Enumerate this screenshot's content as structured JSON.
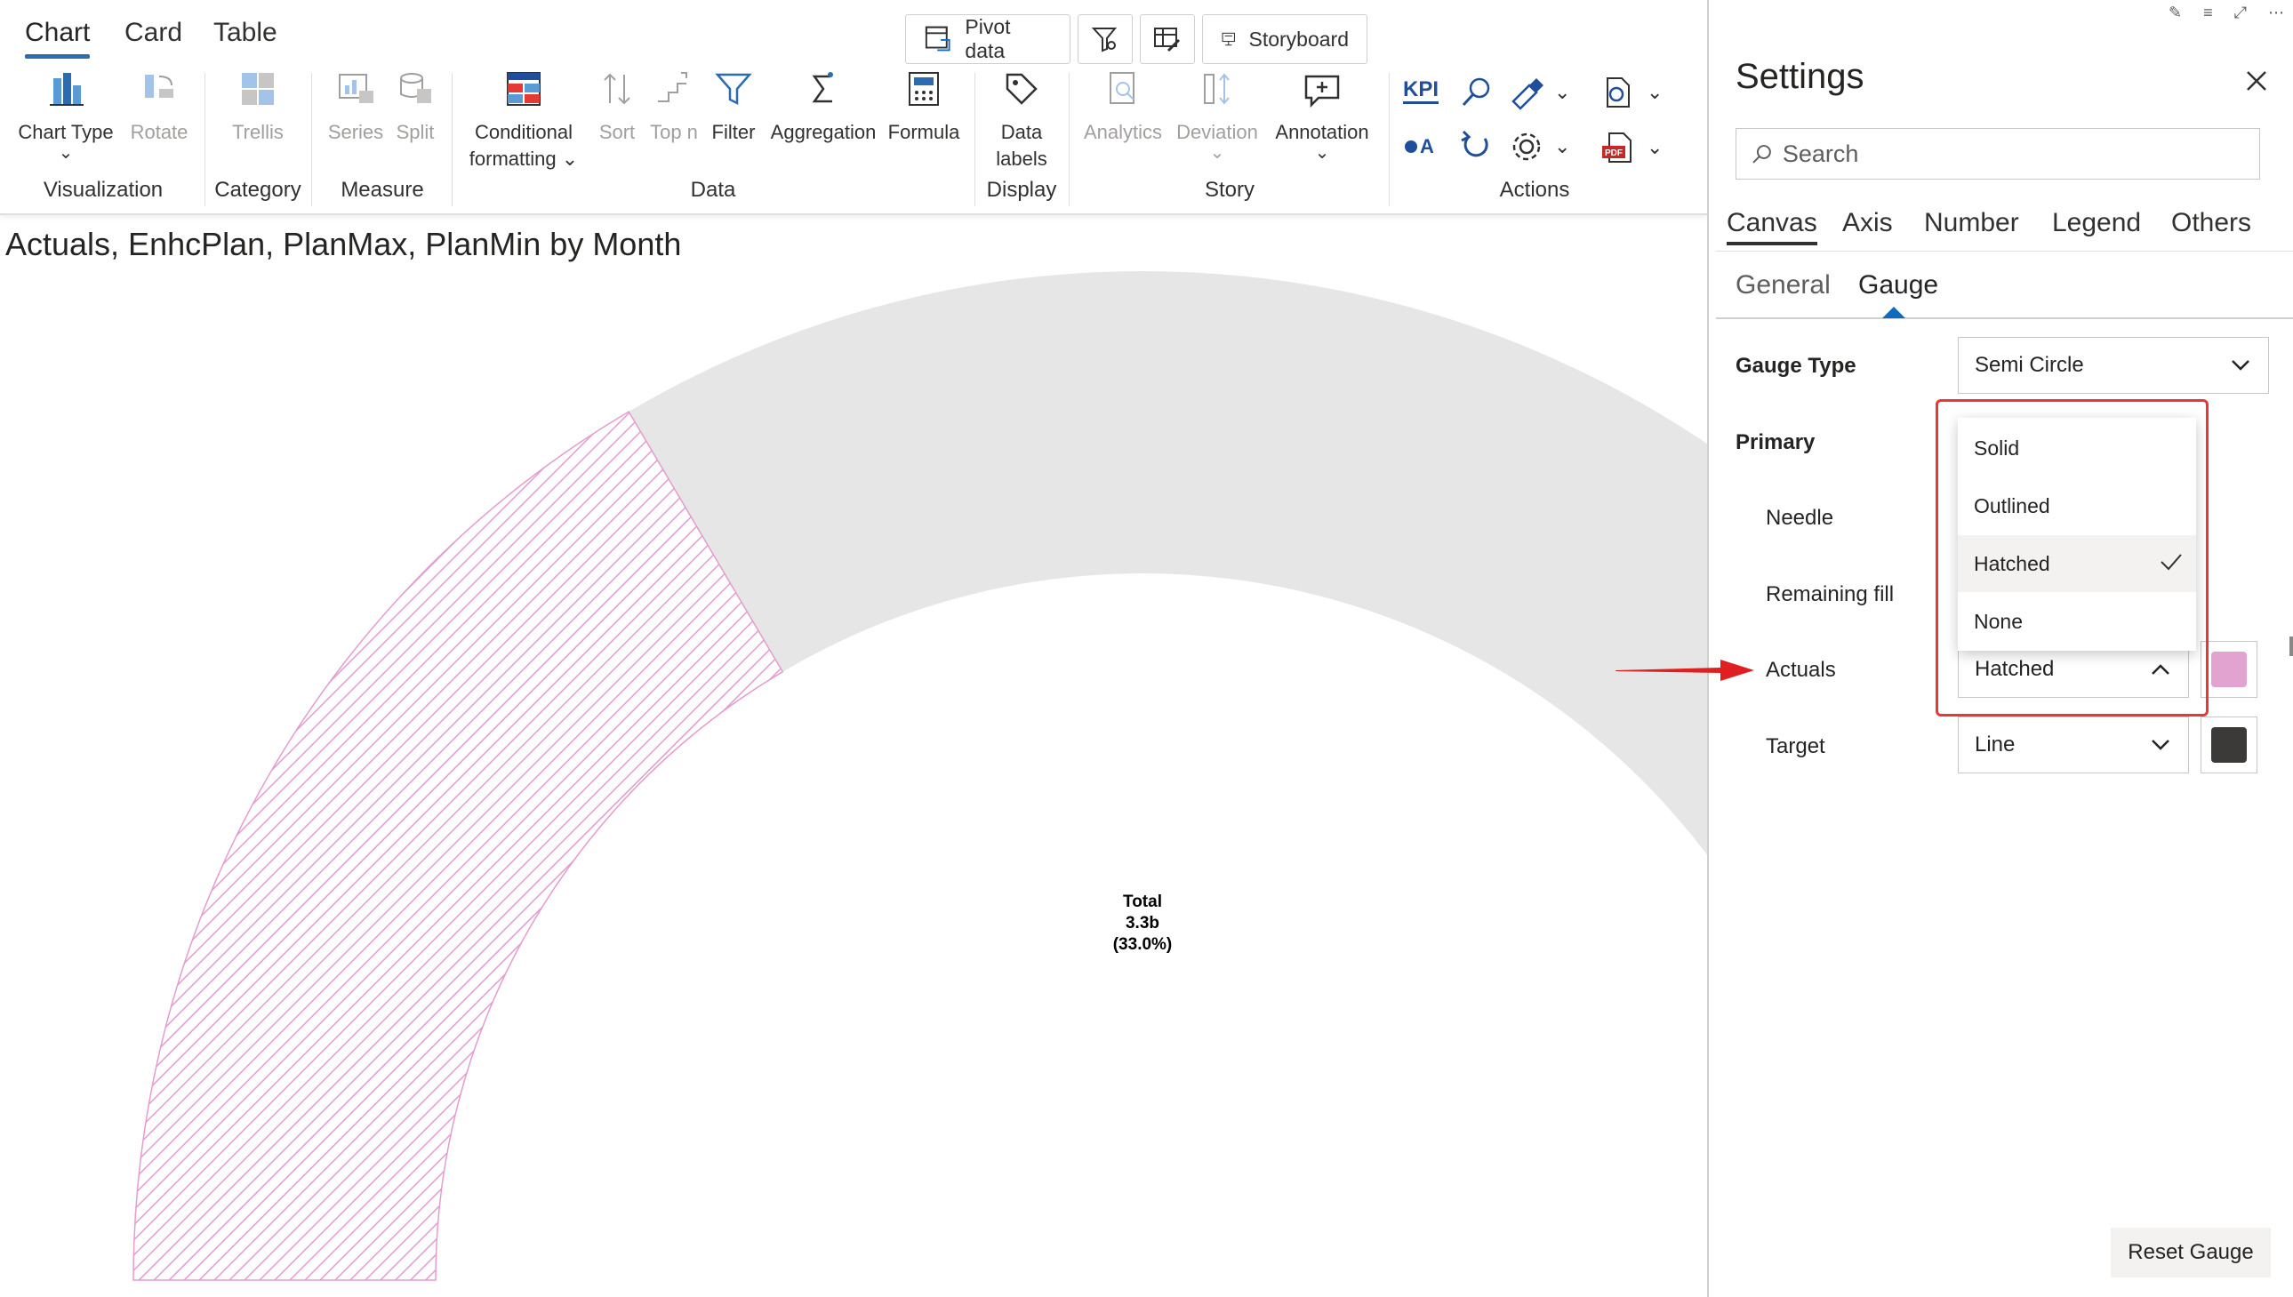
{
  "ribbon": {
    "tabs": [
      "Chart",
      "Card",
      "Table"
    ],
    "top_buttons": {
      "pivot": "Pivot data",
      "storyboard": "Storyboard"
    },
    "buttons": {
      "chart_type": "Chart Type",
      "rotate": "Rotate",
      "trellis": "Trellis",
      "series": "Series",
      "split": "Split",
      "conditional_1": "Conditional",
      "conditional_2": "formatting",
      "sort": "Sort",
      "topn": "Top n",
      "filter": "Filter",
      "aggregation": "Aggregation",
      "formula": "Formula",
      "data_labels_1": "Data",
      "data_labels_2": "labels",
      "analytics": "Analytics",
      "deviation": "Deviation",
      "annotation": "Annotation"
    },
    "groups": {
      "visualization": "Visualization",
      "category": "Category",
      "measure": "Measure",
      "data": "Data",
      "display": "Display",
      "story": "Story",
      "actions": "Actions"
    },
    "actions": {
      "kpi": "KPI",
      "oa": "A",
      "pdf": "PDF"
    }
  },
  "chart": {
    "title": "Actuals, EnhcPlan, PlanMax, PlanMin by Month",
    "center_label": {
      "line1": "Total",
      "line2": "3.3b",
      "line3": "(33.0%)"
    },
    "colors": {
      "actuals_hatch": "#e59bd0",
      "remaining": "#e6e6e6"
    }
  },
  "chart_data": {
    "type": "gauge",
    "gauge_type": "Semi Circle",
    "actuals_fill": "Hatched",
    "total": "3.3b",
    "percent": 33.0
  },
  "settings": {
    "title": "Settings",
    "search_placeholder": "Search",
    "tabs": [
      "Canvas",
      "Axis",
      "Number",
      "Legend",
      "Others"
    ],
    "subtabs": [
      "General",
      "Gauge"
    ],
    "gauge_type_label": "Gauge Type",
    "gauge_type_value": "Semi Circle",
    "primary_label": "Primary",
    "needle_label": "Needle",
    "remaining_fill_label": "Remaining fill",
    "actuals_label": "Actuals",
    "actuals_value": "Hatched",
    "actuals_color": "#e3a3d0",
    "target_label": "Target",
    "target_value": "Line",
    "target_color": "#3b3a39",
    "dropdown_options": [
      "Solid",
      "Outlined",
      "Hatched",
      "None"
    ],
    "selected_option": "Hatched",
    "reset_button": "Reset Gauge"
  }
}
